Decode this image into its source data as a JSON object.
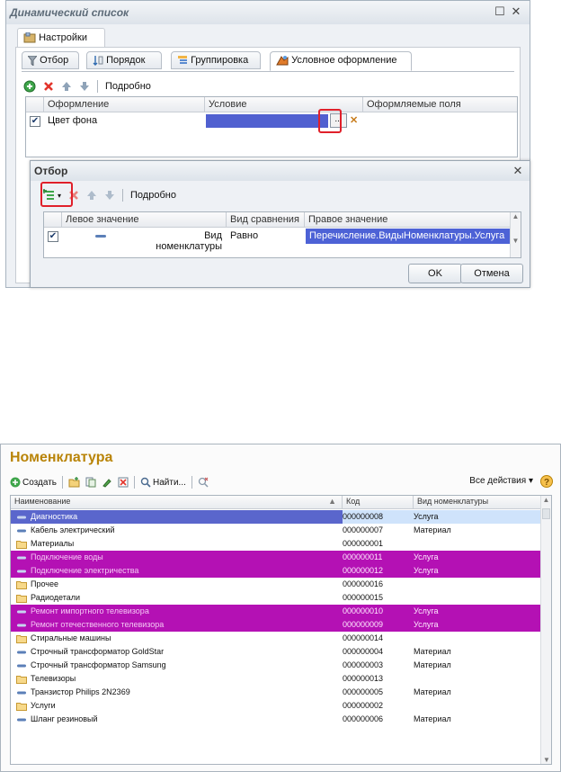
{
  "dialog": {
    "title": "Динамический список",
    "settings_tab": "Настройки",
    "subtabs": [
      "Отбор",
      "Порядок",
      "Группировка",
      "Условное оформление"
    ],
    "toolbar": {
      "more": "Подробно"
    },
    "grid": {
      "headers": [
        "Оформление",
        "Условие",
        "Оформляемые поля"
      ],
      "row": {
        "checked": true,
        "appearance": "Цвет фона",
        "condition": "",
        "fields": ""
      },
      "ellipsis": "..."
    }
  },
  "filter_dialog": {
    "title": "Отбор",
    "toolbar": {
      "more": "Подробно"
    },
    "grid": {
      "headers": [
        "Левое значение",
        "Вид сравнения",
        "Правое значение"
      ],
      "row": {
        "checked": true,
        "left": "Вид номенклатуры",
        "comparison": "Равно",
        "right": "Перечисление.ВидыНоменклатуры.Услуга"
      }
    },
    "ok": "OK",
    "cancel": "Отмена"
  },
  "nomenclature": {
    "title": "Номенклатура",
    "toolbar": {
      "create": "Создать",
      "find": "Найти...",
      "all_actions": "Все действия"
    },
    "headers": [
      "Наименование",
      "Код",
      "Вид номенклатуры"
    ],
    "rows": [
      {
        "name": "Диагностика",
        "code": "000000008",
        "kind": "Услуга",
        "type": "item",
        "style": "sel"
      },
      {
        "name": "Кабель электрический",
        "code": "000000007",
        "kind": "Материал",
        "type": "item",
        "style": ""
      },
      {
        "name": "Материалы",
        "code": "000000001",
        "kind": "",
        "type": "folder",
        "style": ""
      },
      {
        "name": "Подключение воды",
        "code": "000000011",
        "kind": "Услуга",
        "type": "item",
        "style": "mag"
      },
      {
        "name": "Подключение электричества",
        "code": "000000012",
        "kind": "Услуга",
        "type": "item",
        "style": "mag"
      },
      {
        "name": "Прочее",
        "code": "000000016",
        "kind": "",
        "type": "folder",
        "style": ""
      },
      {
        "name": "Радиодетали",
        "code": "000000015",
        "kind": "",
        "type": "folder",
        "style": ""
      },
      {
        "name": "Ремонт импортного телевизора",
        "code": "000000010",
        "kind": "Услуга",
        "type": "item",
        "style": "mag"
      },
      {
        "name": "Ремонт отечественного телевизора",
        "code": "000000009",
        "kind": "Услуга",
        "type": "item",
        "style": "mag"
      },
      {
        "name": "Стиральные машины",
        "code": "000000014",
        "kind": "",
        "type": "folder",
        "style": ""
      },
      {
        "name": "Строчный трансформатор GoldStar",
        "code": "000000004",
        "kind": "Материал",
        "type": "item",
        "style": ""
      },
      {
        "name": "Строчный трансформатор Samsung",
        "code": "000000003",
        "kind": "Материал",
        "type": "item",
        "style": ""
      },
      {
        "name": "Телевизоры",
        "code": "000000013",
        "kind": "",
        "type": "folder",
        "style": ""
      },
      {
        "name": "Транзистор Philips 2N2369",
        "code": "000000005",
        "kind": "Материал",
        "type": "item",
        "style": ""
      },
      {
        "name": "Услуги",
        "code": "000000002",
        "kind": "",
        "type": "folder",
        "style": ""
      },
      {
        "name": "Шланг резиновый",
        "code": "000000006",
        "kind": "Материал",
        "type": "item",
        "style": ""
      }
    ]
  },
  "colors": {
    "condition_fill": "#5060d0",
    "selection_row": "#5a66cc",
    "highlight_row": "#b411b4",
    "title_gold": "#b98408",
    "annotation_red": "#e0202a"
  }
}
